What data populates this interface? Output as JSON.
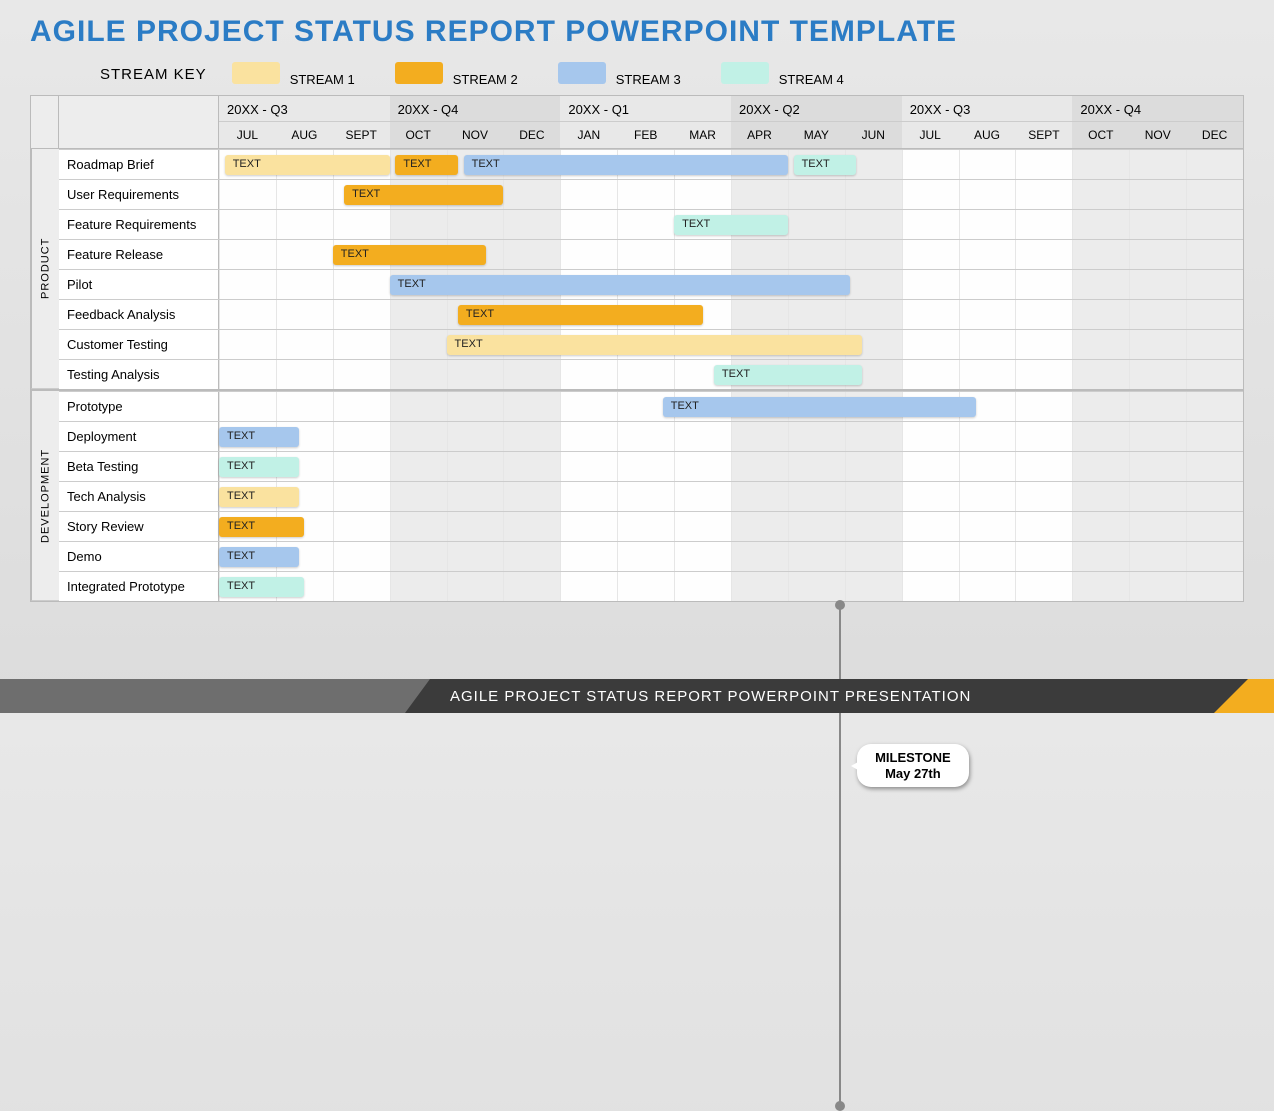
{
  "title": "AGILE PROJECT STATUS REPORT POWERPOINT TEMPLATE",
  "footer": "AGILE PROJECT STATUS REPORT POWERPOINT PRESENTATION",
  "legend": {
    "label": "STREAM KEY",
    "items": [
      {
        "name": "STREAM 1",
        "class": "s1"
      },
      {
        "name": "STREAM 2",
        "class": "s2"
      },
      {
        "name": "STREAM 3",
        "class": "s3"
      },
      {
        "name": "STREAM 4",
        "class": "s4"
      }
    ]
  },
  "milestone": {
    "line1": "MILESTONE",
    "line2": "May 27th",
    "month_index": 10.9
  },
  "chart_data": {
    "type": "gantt",
    "quarters": [
      "20XX - Q3",
      "20XX - Q4",
      "20XX - Q1",
      "20XX - Q2",
      "20XX - Q3",
      "20XX - Q4"
    ],
    "months": [
      "JUL",
      "AUG",
      "SEPT",
      "OCT",
      "NOV",
      "DEC",
      "JAN",
      "FEB",
      "MAR",
      "APR",
      "MAY",
      "JUN",
      "JUL",
      "AUG",
      "SEPT",
      "OCT",
      "NOV",
      "DEC"
    ],
    "groups": [
      {
        "name": "PRODUCT",
        "tasks": [
          {
            "name": "Roadmap Brief",
            "bars": [
              {
                "stream": "s1",
                "text": "TEXT",
                "start": 0.1,
                "end": 3.0
              },
              {
                "stream": "s2",
                "text": "TEXT",
                "start": 3.1,
                "end": 4.2
              },
              {
                "stream": "s3",
                "text": "TEXT",
                "start": 4.3,
                "end": 10.0
              },
              {
                "stream": "s4",
                "text": "TEXT",
                "start": 10.1,
                "end": 11.2
              }
            ]
          },
          {
            "name": "User Requirements",
            "bars": [
              {
                "stream": "s2",
                "text": "TEXT",
                "start": 2.2,
                "end": 5.0
              }
            ]
          },
          {
            "name": "Feature Requirements",
            "bars": [
              {
                "stream": "s4",
                "text": "TEXT",
                "start": 8.0,
                "end": 10.0
              }
            ]
          },
          {
            "name": "Feature Release",
            "bars": [
              {
                "stream": "s2",
                "text": "TEXT",
                "start": 2.0,
                "end": 4.7
              }
            ]
          },
          {
            "name": "Pilot",
            "bars": [
              {
                "stream": "s3",
                "text": "TEXT",
                "start": 3.0,
                "end": 11.1
              }
            ]
          },
          {
            "name": "Feedback Analysis",
            "bars": [
              {
                "stream": "s2",
                "text": "TEXT",
                "start": 4.2,
                "end": 8.5
              }
            ]
          },
          {
            "name": "Customer Testing",
            "bars": [
              {
                "stream": "s1",
                "text": "TEXT",
                "start": 4.0,
                "end": 11.3
              }
            ]
          },
          {
            "name": "Testing Analysis",
            "bars": [
              {
                "stream": "s4",
                "text": "TEXT",
                "start": 8.7,
                "end": 11.3
              }
            ]
          }
        ]
      },
      {
        "name": "DEVELOPMENT",
        "tasks": [
          {
            "name": "Prototype",
            "bars": [
              {
                "stream": "s3",
                "text": "TEXT",
                "start": 7.8,
                "end": 13.3
              }
            ]
          },
          {
            "name": "Deployment",
            "bars": [
              {
                "stream": "s3",
                "text": "TEXT",
                "start": 0.0,
                "end": 1.4
              }
            ]
          },
          {
            "name": "Beta Testing",
            "bars": [
              {
                "stream": "s4",
                "text": "TEXT",
                "start": 0.0,
                "end": 1.4
              }
            ]
          },
          {
            "name": "Tech Analysis",
            "bars": [
              {
                "stream": "s1",
                "text": "TEXT",
                "start": 0.0,
                "end": 1.4
              }
            ]
          },
          {
            "name": "Story Review",
            "bars": [
              {
                "stream": "s2",
                "text": "TEXT",
                "start": 0.0,
                "end": 1.5
              }
            ]
          },
          {
            "name": "Demo",
            "bars": [
              {
                "stream": "s3",
                "text": "TEXT",
                "start": 0.0,
                "end": 1.4
              }
            ]
          },
          {
            "name": "Integrated Prototype",
            "bars": [
              {
                "stream": "s4",
                "text": "TEXT",
                "start": 0.0,
                "end": 1.5
              }
            ]
          }
        ]
      }
    ]
  }
}
